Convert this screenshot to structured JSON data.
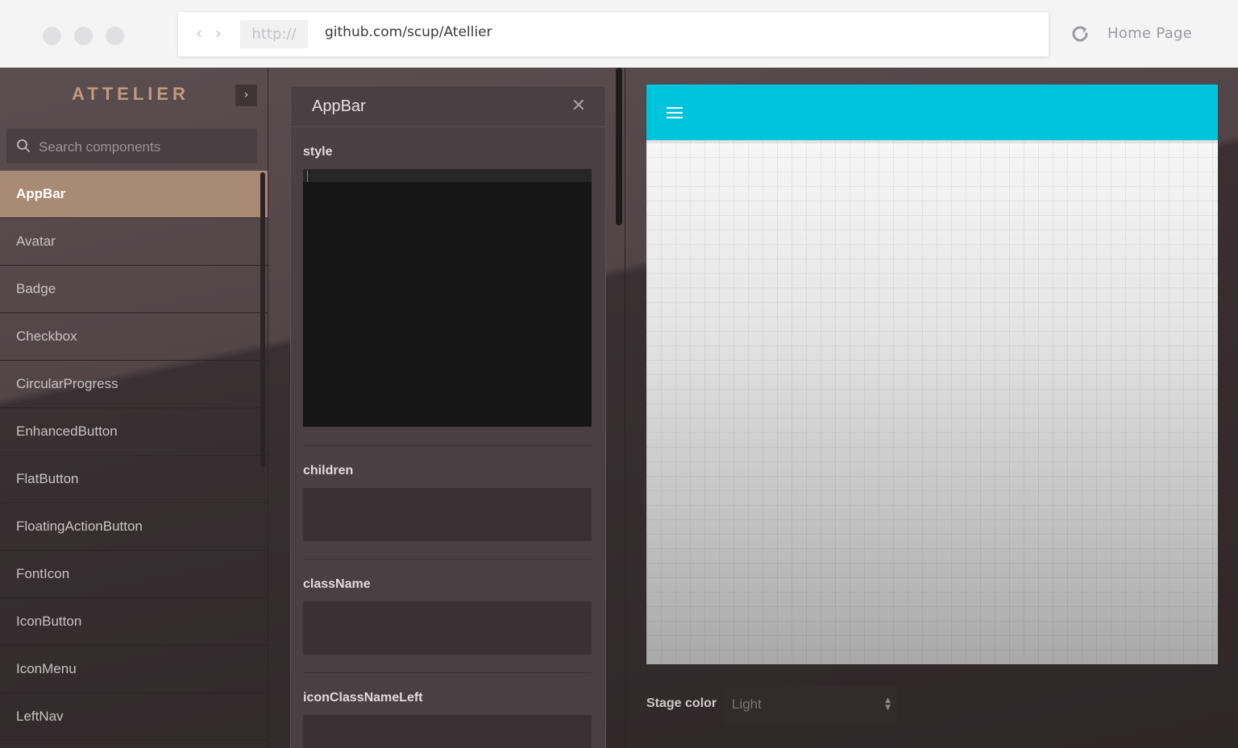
{
  "browser": {
    "protocol": "http://",
    "url": "github.com/scup/Atellier",
    "home_label": "Home Page",
    "back_glyph": "‹",
    "forward_glyph": "›",
    "reload_icon": "reload-icon"
  },
  "sidebar": {
    "brand": "ATTELIER",
    "collapse_glyph": "›",
    "search_placeholder": "Search components",
    "active_index": 0,
    "active_color": "#a88a75",
    "items": [
      {
        "label": "AppBar"
      },
      {
        "label": "Avatar"
      },
      {
        "label": "Badge"
      },
      {
        "label": "Checkbox"
      },
      {
        "label": "CircularProgress"
      },
      {
        "label": "EnhancedButton"
      },
      {
        "label": "FlatButton"
      },
      {
        "label": "FloatingActionButton"
      },
      {
        "label": "FontIcon"
      },
      {
        "label": "IconButton"
      },
      {
        "label": "IconMenu"
      },
      {
        "label": "LeftNav"
      }
    ]
  },
  "props_panel": {
    "title": "AppBar",
    "close_glyph": "✕",
    "props": [
      {
        "label": "style"
      },
      {
        "label": "children"
      },
      {
        "label": "className"
      },
      {
        "label": "iconClassNameLeft"
      }
    ]
  },
  "preview": {
    "appbar_color": "#00c4dc",
    "menu_icon": "hamburger-menu-icon"
  },
  "stage": {
    "label": "Stage color",
    "value": "Light",
    "arrows_up": "▲",
    "arrows_down": "▼"
  }
}
